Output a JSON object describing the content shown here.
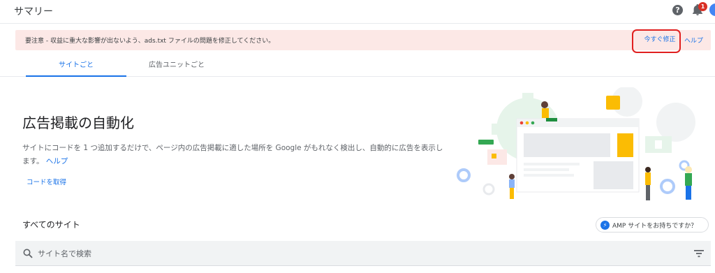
{
  "header": {
    "title": "サマリー",
    "help_glyph": "?",
    "notification_count": "1"
  },
  "banner": {
    "message": "要注意 - 収益に重大な影響が出ないよう、ads.txt ファイルの問題を修正してください。",
    "fix_label": "今すぐ修正",
    "help_label": "ヘルプ"
  },
  "tabs": [
    {
      "label": "サイトごと",
      "active": true
    },
    {
      "label": "広告ユニットごと",
      "active": false
    }
  ],
  "hero": {
    "title": "広告掲載の自動化",
    "description": "サイトにコードを 1 つ追加するだけで、ページ内の広告掲載に適した場所を Google がもれなく検出し、自動的に広告を表示します。",
    "help_link": "ヘルプ",
    "get_code": "コードを取得"
  },
  "sites": {
    "heading": "すべてのサイト",
    "amp_button": "AMP サイトをお持ちですか？",
    "amp_icon_glyph": "⚡"
  },
  "search": {
    "placeholder": "サイト名で検索",
    "value": ""
  },
  "colors": {
    "accent": "#1a73e8",
    "banner_bg": "#fce8e6",
    "highlight": "#e02020",
    "badge": "#d93025"
  },
  "icons": [
    "help-icon",
    "bell-icon",
    "avatar",
    "search-icon",
    "filter-icon",
    "amp-bolt-icon"
  ]
}
